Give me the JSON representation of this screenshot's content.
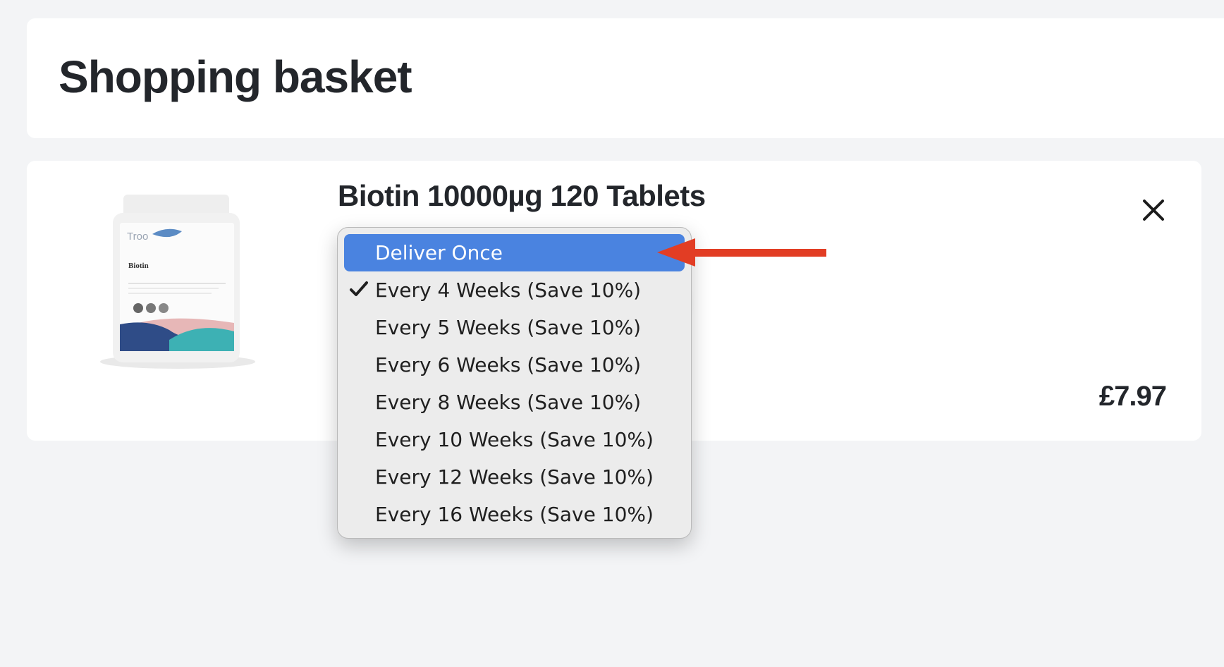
{
  "page": {
    "title": "Shopping basket"
  },
  "item": {
    "name": "Biotin 10000µg 120 Tablets",
    "price": "£7.97",
    "image": {
      "brand_text": "Troo",
      "product_text": "Biotin"
    },
    "remove_icon": "close-icon"
  },
  "delivery_options": {
    "highlighted": "Deliver Once",
    "selected": "Every 4 Weeks (Save 10%)",
    "items": [
      "Deliver Once",
      "Every 4 Weeks (Save 10%)",
      "Every 5 Weeks (Save 10%)",
      "Every 6 Weeks (Save 10%)",
      "Every 8 Weeks (Save 10%)",
      "Every 10 Weeks (Save 10%)",
      "Every 12 Weeks (Save 10%)",
      "Every 16 Weeks (Save 10%)"
    ]
  },
  "annotation": {
    "type": "red-arrow",
    "points_to": "Deliver Once",
    "color": "#e23d24"
  },
  "colors": {
    "highlight": "#4a83e0",
    "text": "#23262b",
    "background": "#f3f4f6"
  }
}
